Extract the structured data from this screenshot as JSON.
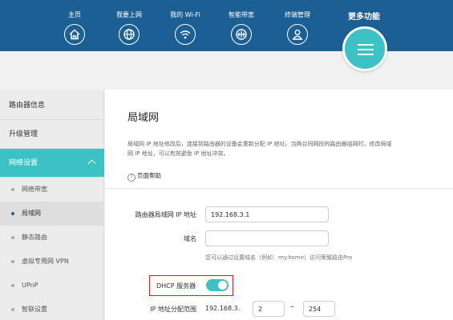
{
  "nav": {
    "items": [
      {
        "label": "主页",
        "icon": "home-icon"
      },
      {
        "label": "我要上网",
        "icon": "globe-icon"
      },
      {
        "label": "我的 Wi-Fi",
        "icon": "wifi-icon"
      },
      {
        "label": "智能带宽",
        "icon": "bandwidth-icon"
      },
      {
        "label": "终端管理",
        "icon": "user-icon"
      }
    ],
    "more_label": "更多功能",
    "more_icon": "menu-icon"
  },
  "sidebar": {
    "items": [
      "路由器信息",
      "升级管理",
      "网络设置"
    ],
    "subitems": [
      "网络带宽",
      "局域网",
      "静态路由",
      "虚拟专用网 VPN",
      "UPnP",
      "智联设置"
    ]
  },
  "main": {
    "title": "局域网",
    "description_line1": "局域网 IP 地址修改后，连接到路由器的设备会重新分配 IP 地址。当两台同网段的路由器组网时，修改局域",
    "description_line2": "网 IP 地址，可以有效避免 IP 地址冲突。",
    "help_label": "页面帮助",
    "ip_label": "路由器局域网 IP 地址",
    "ip_value": "192.168.3.1",
    "domain_label": "域名",
    "domain_value": "",
    "domain_hint": "您可以通过设置域名（例如：my.home）访问荣耀路由Pro",
    "dhcp_label": "DHCP 服务器",
    "dhcp_enabled": true,
    "range_label": "IP 地址分配范围",
    "range_prefix": "192.168.3.",
    "range_start": "2",
    "range_end": "254"
  },
  "colors": {
    "nav_bg": "#1b5f95",
    "accent": "#3cc2c5",
    "highlight_border": "#c8262a"
  }
}
